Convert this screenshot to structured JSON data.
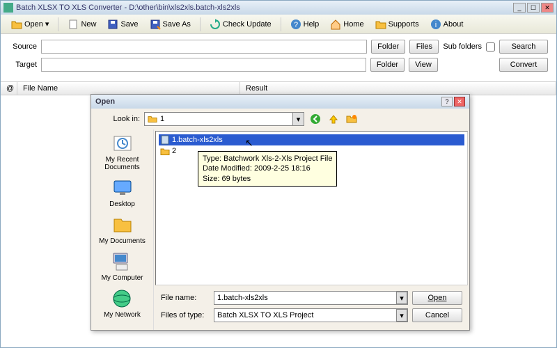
{
  "window": {
    "title": "Batch XLSX TO XLS Converter - D:\\other\\bin\\xls2xls.batch-xls2xls"
  },
  "toolbar": {
    "open": "Open",
    "new": "New",
    "save": "Save",
    "saveas": "Save As",
    "check": "Check Update",
    "help": "Help",
    "home": "Home",
    "supports": "Supports",
    "about": "About"
  },
  "form": {
    "source_label": "Source",
    "source_value": "",
    "folder_btn": "Folder",
    "files_btn": "Files",
    "subfolders_label": "Sub folders",
    "search_btn": "Search",
    "target_label": "Target",
    "target_value": "",
    "view_btn": "View",
    "convert_btn": "Convert"
  },
  "list": {
    "at": "@",
    "filename": "File Name",
    "result": "Result"
  },
  "dialog": {
    "title": "Open",
    "lookin_label": "Look in:",
    "lookin_value": "1",
    "places": {
      "recent": "My Recent Documents",
      "desktop": "Desktop",
      "mydocs": "My Documents",
      "mycomp": "My Computer",
      "mynet": "My Network"
    },
    "files": [
      {
        "name": "1.batch-xls2xls",
        "type": "file"
      },
      {
        "name": "2",
        "type": "folder"
      }
    ],
    "tooltip": {
      "type": "Type: Batchwork Xls-2-Xls Project File",
      "date": "Date Modified: 2009-2-25 18:16",
      "size": "Size: 69 bytes"
    },
    "filename_label": "File name:",
    "filename_value": "1.batch-xls2xls",
    "filetype_label": "Files of type:",
    "filetype_value": "Batch XLSX TO XLS Project",
    "open_btn": "Open",
    "cancel_btn": "Cancel"
  }
}
